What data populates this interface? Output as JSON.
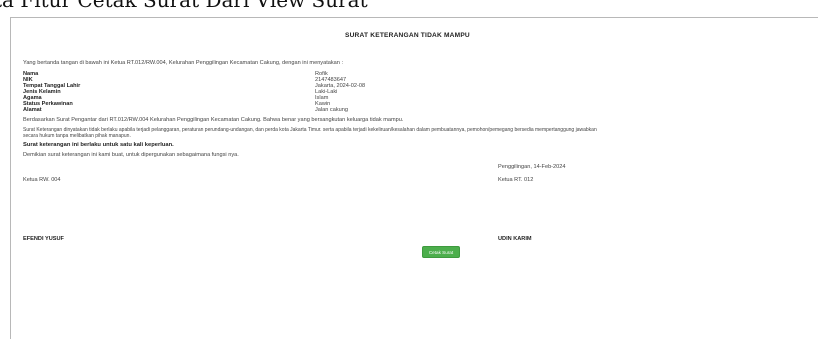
{
  "page_caption": "ta Fitur Cetak Surat Dari View Surat",
  "document": {
    "title": "SURAT KETERANGAN TIDAK MAMPU",
    "intro": "Yang bertanda tangan di bawah ini Ketua RT.012/RW.004, Kelurahan Penggilingan Kecamatan Cakung, dengan ini menyatakan :",
    "fields": [
      {
        "label": "Nama",
        "value": "Rofik"
      },
      {
        "label": "NIK",
        "value": "2147483647"
      },
      {
        "label": "Tempat Tanggal Lahir",
        "value": "Jakarta, 2024-02-08"
      },
      {
        "label": "Jenis Kelamin",
        "value": "Laki-Laki"
      },
      {
        "label": "Agama",
        "value": "Islam"
      },
      {
        "label": "Status Perkawinan",
        "value": "Kawin"
      },
      {
        "label": "Alamat",
        "value": "Jalan cakung"
      }
    ],
    "statement": "Berdasarkan Surat Pengantar dari RT.012/RW.004 Kelurahan Penggilingan Kecamatan Cakung. Bahwa benar yang bersangkutan keluarga tidak mampu.",
    "disclaimer_line1": "Surat Keterangan dinyatakan tidak berlaku apabila terjadi pelanggaran, peraturan perundang-undangan, dan perda kota Jakarta Timur. serta apabila terjadi kekeliruan/kesalahan dalam pembuatannya, pemohon/pemegang bersedia mempertanggung jawabkan",
    "disclaimer_line2": "secara hukum tanpa melibatkan pihak manapun.",
    "validity": "Surat keterangan ini berlaku untuk satu kali keperluan.",
    "closing": "Demikian surat keterangan ini kami buat, untuk dipergunakan sebagaimana fungsi nya.",
    "place_date": "Penggilingan, 14-Feb-2024",
    "signer_left_title": "Ketua RW. 004",
    "signer_right_title": "Ketua RT. 012",
    "signer_left_name": "EFENDI YUSUF",
    "signer_right_name": "UDIN KARIM",
    "print_button": "Cetak Surat"
  },
  "colors": {
    "button": "#4cae4c"
  }
}
